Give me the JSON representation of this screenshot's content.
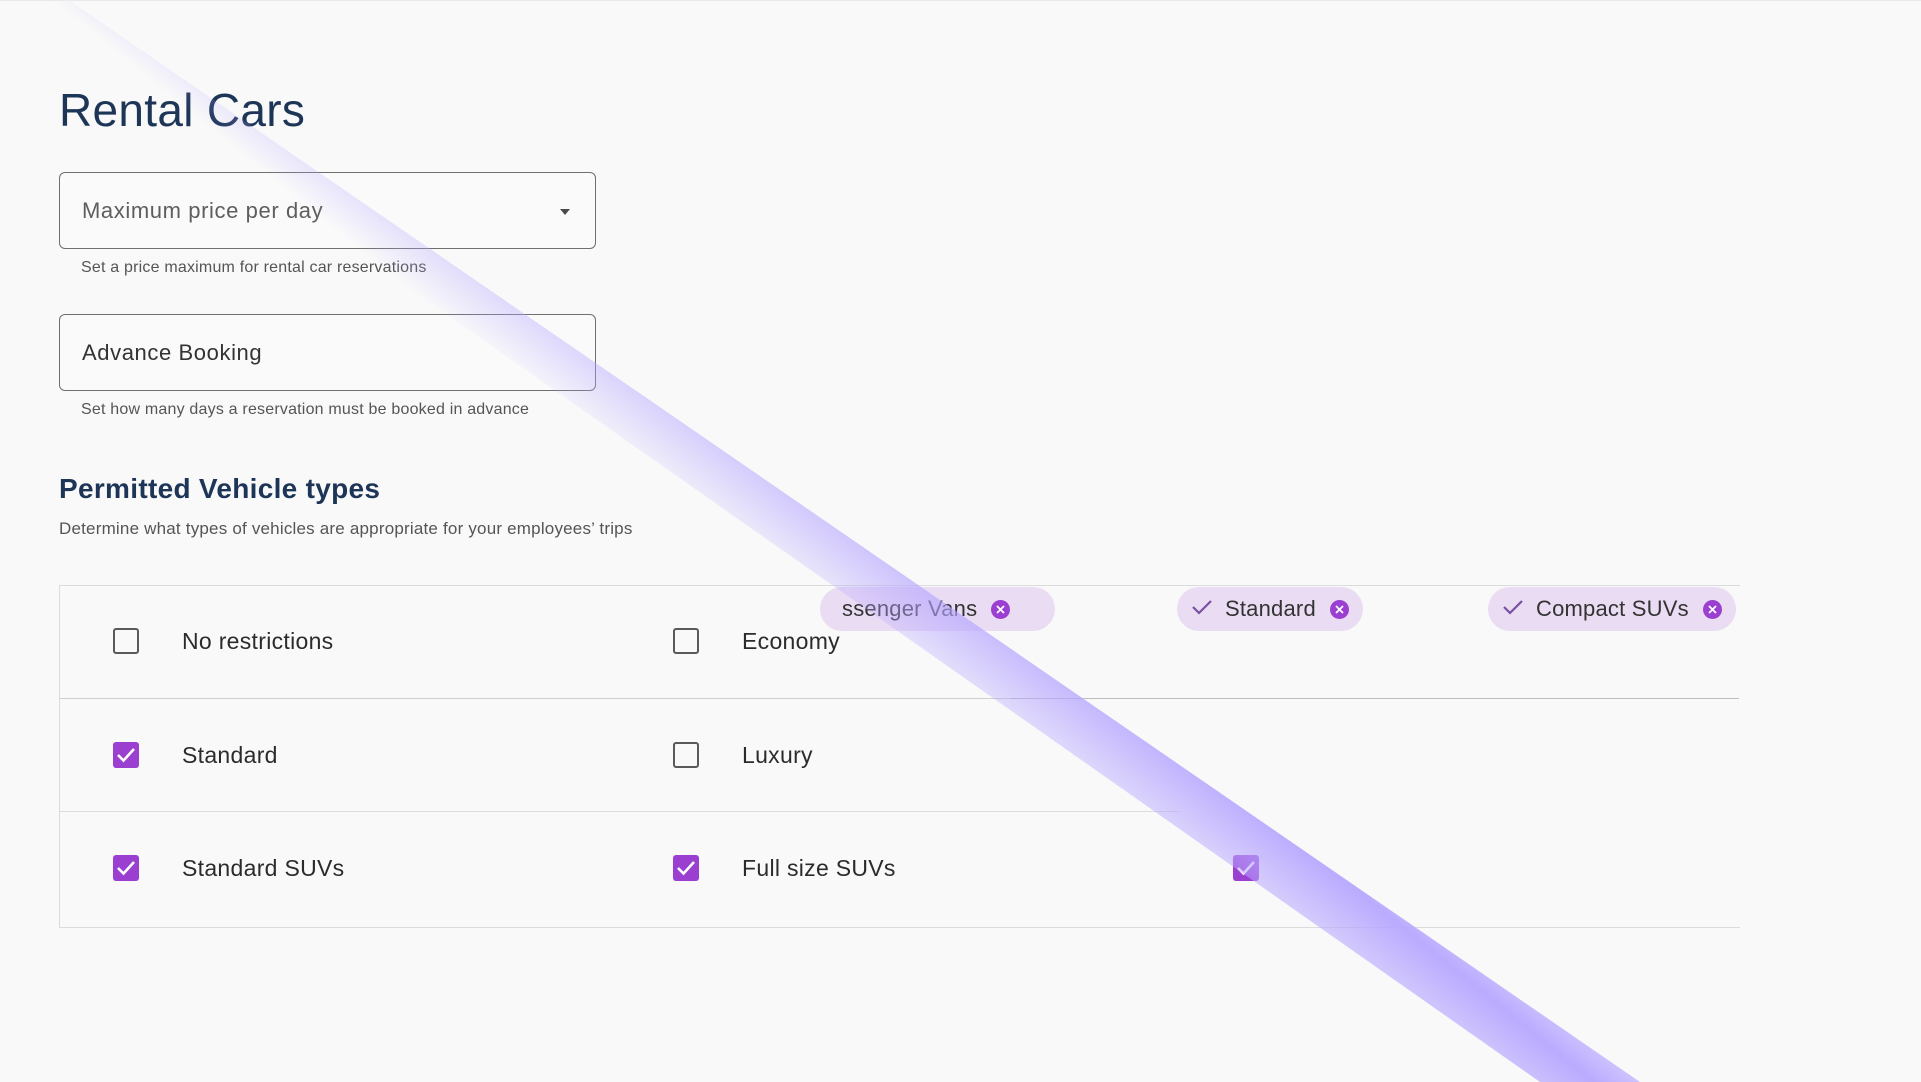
{
  "page": {
    "title": "Rental Cars"
  },
  "price_field": {
    "value": "Maximum price per day",
    "helper": "Set a price maximum for rental car reservations"
  },
  "booking_field": {
    "value": "Advance Booking",
    "helper": "Set how many days a reservation must be booked in advance"
  },
  "vehicle_types": {
    "title": "Permitted Vehicle types",
    "description": "Determine what types of vehicles are appropriate for your employees’ trips",
    "options": [
      {
        "label": "No restrictions",
        "checked": false
      },
      {
        "label": "Economy",
        "checked": false
      },
      {
        "label": "Standard",
        "checked": true
      },
      {
        "label": "Luxury",
        "checked": false
      },
      {
        "label": "Standard SUVs",
        "checked": true
      },
      {
        "label": "Full size SUVs",
        "checked": true
      },
      {
        "label": "",
        "checked": true
      }
    ]
  },
  "chips": [
    {
      "label": "ssenger Vans",
      "selected": true
    },
    {
      "label": "Standard",
      "selected": true
    },
    {
      "label": "Compact SUVs",
      "selected": true
    }
  ],
  "colors": {
    "accent": "#9b3fd1",
    "chip_bg": "#eadcf3",
    "heading": "#1d3557",
    "sweep": "#b7a7ff"
  }
}
